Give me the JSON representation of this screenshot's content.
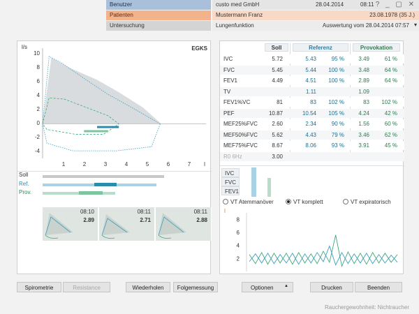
{
  "header": {
    "benutzer_label": "Benutzer",
    "benutzer_value": "custo med GmbH",
    "date": "28.04.2014",
    "time": "08:11",
    "window_icons": "? _ ▢ ✕",
    "patient_label": "Patienten",
    "patient_name": "Mustermann Franz",
    "patient_birth": "23.08.1978 (35 J.)",
    "untersuchung_label": "Untersuchung",
    "untersuchung_value": "Lungenfunktion",
    "auswertung": "Auswertung vom 28.04.2014  07:57"
  },
  "flow_volume_chart": {
    "unit": "l/s",
    "code": "EGKS",
    "y_ticks": [
      "10",
      "8",
      "6",
      "4",
      "2",
      "0",
      "-2",
      "-4"
    ],
    "x_ticks": [
      "1",
      "2",
      "3",
      "4",
      "5",
      "6",
      "7",
      "l"
    ],
    "x_range": [
      0,
      7.5
    ],
    "y_range": [
      -5,
      11
    ],
    "colors": {
      "predicted_area": "#d9dcde",
      "measured": "#3a9fc0",
      "provocation": "#3aa87a"
    }
  },
  "comparison": {
    "labels": [
      "Soll",
      "Ref.",
      "Prov."
    ],
    "label_colors": [
      "#333333",
      "#2b8cb5",
      "#2f8a5a"
    ]
  },
  "curves": [
    {
      "time": "08:10",
      "value": "2.89"
    },
    {
      "time": "08:11",
      "value": "2.71"
    },
    {
      "time": "08:11",
      "value": "2.88"
    }
  ],
  "table": {
    "headers": {
      "soll": "Soll",
      "referenz": "Referenz",
      "provokation": "Provokation"
    },
    "rows": [
      {
        "param": "IVC",
        "soll": "5.72",
        "ref_val": "5.43",
        "ref_pct": "95 %",
        "prov_val": "3.49",
        "prov_pct": "61 %"
      },
      {
        "param": "FVC",
        "soll": "5.45",
        "ref_val": "5.44",
        "ref_pct": "100 %",
        "prov_val": "3.48",
        "prov_pct": "64 %"
      },
      {
        "param": "FEV1",
        "soll": "4.49",
        "ref_val": "4.51",
        "ref_pct": "100 %",
        "prov_val": "2.89",
        "prov_pct": "64 %"
      },
      {
        "param": "TV",
        "soll": "",
        "ref_val": "1.11",
        "ref_pct": "",
        "prov_val": "1.09",
        "prov_pct": ""
      },
      {
        "param": "FEV1%VC",
        "soll": "81",
        "ref_val": "83",
        "ref_pct": "102 %",
        "prov_val": "83",
        "prov_pct": "102 %"
      },
      {
        "param": "PEF",
        "soll": "10.87",
        "ref_val": "10.54",
        "ref_pct": "105 %",
        "prov_val": "4.24",
        "prov_pct": "42 %"
      },
      {
        "param": "MEF25%FVC",
        "soll": "2.60",
        "ref_val": "2.34",
        "ref_pct": "90 %",
        "prov_val": "1.56",
        "prov_pct": "60 %"
      },
      {
        "param": "MEF50%FVC",
        "soll": "5.62",
        "ref_val": "4.43",
        "ref_pct": "79 %",
        "prov_val": "3.46",
        "prov_pct": "62 %"
      },
      {
        "param": "MEF75%FVC",
        "soll": "8.67",
        "ref_val": "8.06",
        "ref_pct": "93 %",
        "prov_val": "3.91",
        "prov_pct": "45 %"
      },
      {
        "param": "R0 6Hz",
        "soll": "3.00",
        "ref_val": "",
        "ref_pct": "",
        "prov_val": "",
        "prov_pct": ""
      }
    ]
  },
  "volume_bars": {
    "labels": [
      "IVC",
      "FVC",
      "FEV1"
    ],
    "ref_values": [
      5.43,
      5.44,
      4.51
    ],
    "prov_values": [
      3.49,
      3.48,
      2.89
    ]
  },
  "vt_options": [
    {
      "label": "VT Atemmanöver",
      "selected": false
    },
    {
      "label": "VT komplett",
      "selected": true
    },
    {
      "label": "VT expiratorisch",
      "selected": false
    }
  ],
  "vt_chart": {
    "y_ticks": [
      "8",
      "6",
      "4",
      "2"
    ],
    "y_range": [
      0,
      9
    ],
    "series": [
      {
        "color": "#3aa87a",
        "values": [
          2.6,
          1.2,
          2.9,
          1.1,
          2.8,
          1.3,
          2.8,
          1.1,
          2.9,
          1.3,
          2.7,
          1.2,
          3.1,
          1.4,
          5.6,
          0.8,
          3.0,
          1.2,
          2.8,
          1.1,
          2.9,
          1.3,
          2.8,
          1.4,
          2.6
        ]
      },
      {
        "color": "#3a9fc0",
        "values": [
          1.5,
          2.7,
          1.3,
          2.8,
          1.2,
          2.6,
          1.3,
          2.8,
          1.1,
          2.7,
          1.3,
          2.9,
          1.5,
          3.9,
          1.0,
          2.9,
          1.2,
          2.7,
          1.3,
          2.8,
          1.2,
          2.6,
          1.3,
          2.5,
          1.4
        ]
      }
    ]
  },
  "bottom_bar": {
    "spirometrie": "Spirometrie",
    "resistance": "Resistance",
    "wiederholen": "Wiederholen",
    "folgemessung": "Folgemessung",
    "optionen": "Optionen",
    "optionen_arrow": "▲",
    "drucken": "Drucken",
    "beenden": "Beenden"
  },
  "status_text": "Rauchergewohnheit: Nichtraucher"
}
